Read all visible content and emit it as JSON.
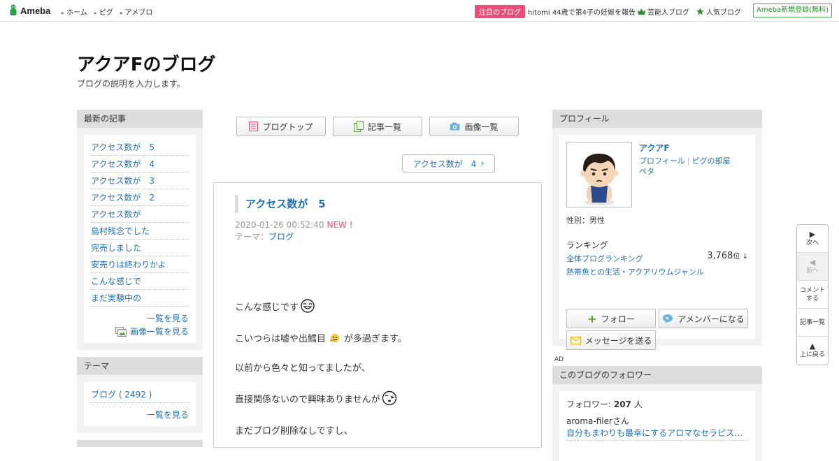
{
  "topbar": {
    "logo": "Ameba",
    "nav": [
      "ホーム",
      "ピグ",
      "アメブロ"
    ],
    "featured_badge": "注目のブログ",
    "featured_text": "hitomi 44歳で第4子の妊娠を報告",
    "celebrity_blog": "芸能人ブログ",
    "popular_blog": "人気ブログ",
    "register": "Ameba新規登録(無料)"
  },
  "header": {
    "title": "アクアFのブログ",
    "description": "ブログの説明を入力します。"
  },
  "recent": {
    "heading": "最新の記事",
    "items": [
      "アクセス数が　5",
      "アクセス数が　4",
      "アクセス数が　3",
      "アクセス数が　2",
      "アクセス数が",
      "島村残念でした",
      "完売しました",
      "安売りは終わりかよ",
      "こんな感じで",
      "まだ実験中の"
    ],
    "more": "一覧を見る",
    "images_more": "画像一覧を見る"
  },
  "theme": {
    "heading": "テーマ",
    "item": "ブログ ( 2492 )",
    "more": "一覧を見る"
  },
  "center": {
    "blog_top": "ブログトップ",
    "article_list": "記事一覧",
    "image_list": "画像一覧",
    "prev_article": "アクセス数が　4"
  },
  "article": {
    "title": "アクセス数が　5",
    "date": "2020-01-26 00:52:40",
    "new": "NEW !",
    "theme_label": "テーマ：",
    "theme": "ブログ",
    "lines": [
      "こんな感じです",
      "こいつらは嘘や出鱈目",
      "が多過ぎます。",
      "以前から色々と知ってましたが、",
      "直接関係ないので興味ありませんが",
      "まだブログ削除なしですし、"
    ]
  },
  "profile": {
    "heading": "プロフィール",
    "name": "アクアF",
    "profile_link": "プロフィール",
    "pigg_room": "ピグの部屋",
    "peta": "ペタ",
    "gender": "性別：男性",
    "ranking_label": "ランキング",
    "all_ranking": "全体ブログランキング",
    "rank": "3,768",
    "rank_unit": "位 ↓",
    "genre": "熱帯魚との生活・アクアリウムジャンル",
    "follow": "フォロー",
    "member": "アメンバーになる",
    "message": "メッセージを送る"
  },
  "ad_label": "AD",
  "followers": {
    "heading": "このブログのフォロワー",
    "label": "フォロワー: ",
    "count": "207",
    "unit": " 人",
    "follower_name": "aroma-filerさん",
    "follower_blog": "自分もまわりも最幸にするアロマなセラピス…"
  },
  "sidenav": {
    "next": "次へ",
    "prev": "前へ",
    "comment_1": "コメント",
    "comment_2": "する",
    "list": "記事一覧",
    "top": "上に戻る"
  },
  "colors": {
    "link": "#1f6fb2",
    "accent_pink": "#e84f7a",
    "green": "#2e8b2e"
  }
}
